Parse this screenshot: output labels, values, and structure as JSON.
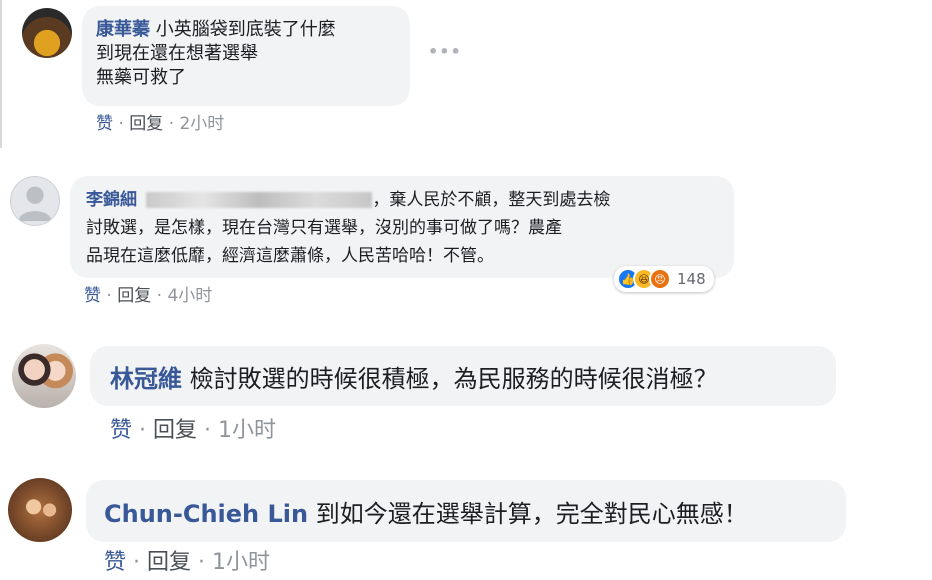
{
  "comments": [
    {
      "author": "康華蓁",
      "lines": [
        "小英腦袋到底裝了什麼",
        "到現在還在想著選舉",
        "無藥可救了"
      ],
      "actions": {
        "like": "赞",
        "reply": "回复",
        "time": "2小时"
      },
      "more_icon": "more-horizontal-icon"
    },
    {
      "author": "李錦細",
      "line1_tail": "，棄人民於不顧，整天到處去檢",
      "line2": "討敗選，是怎樣，現在台灣只有選舉，沒別的事可做了嗎？農產",
      "line3": "品現在這麼低靡，經濟這麼蕭條，人民苦哈哈！不管。",
      "reaction_icons": [
        "like-reaction-icon",
        "haha-reaction-icon",
        "angry-reaction-icon"
      ],
      "reaction_count": "148",
      "actions": {
        "like": "赞",
        "reply": "回复",
        "time": "4小时"
      }
    },
    {
      "author": "林冠維",
      "text": "檢討敗選的時候很積極，為民服務的時候很消極？",
      "actions": {
        "like": "赞",
        "reply": "回复",
        "time": "1小时"
      }
    },
    {
      "author": "Chun-Chieh Lin",
      "text": "到如今還在選舉計算，完全對民心無感！",
      "actions": {
        "like": "赞",
        "reply": "回复",
        "time": "1小时"
      }
    }
  ],
  "colors": {
    "author": "#385898",
    "bubble": "#f2f3f5",
    "meta": "#90949c"
  }
}
